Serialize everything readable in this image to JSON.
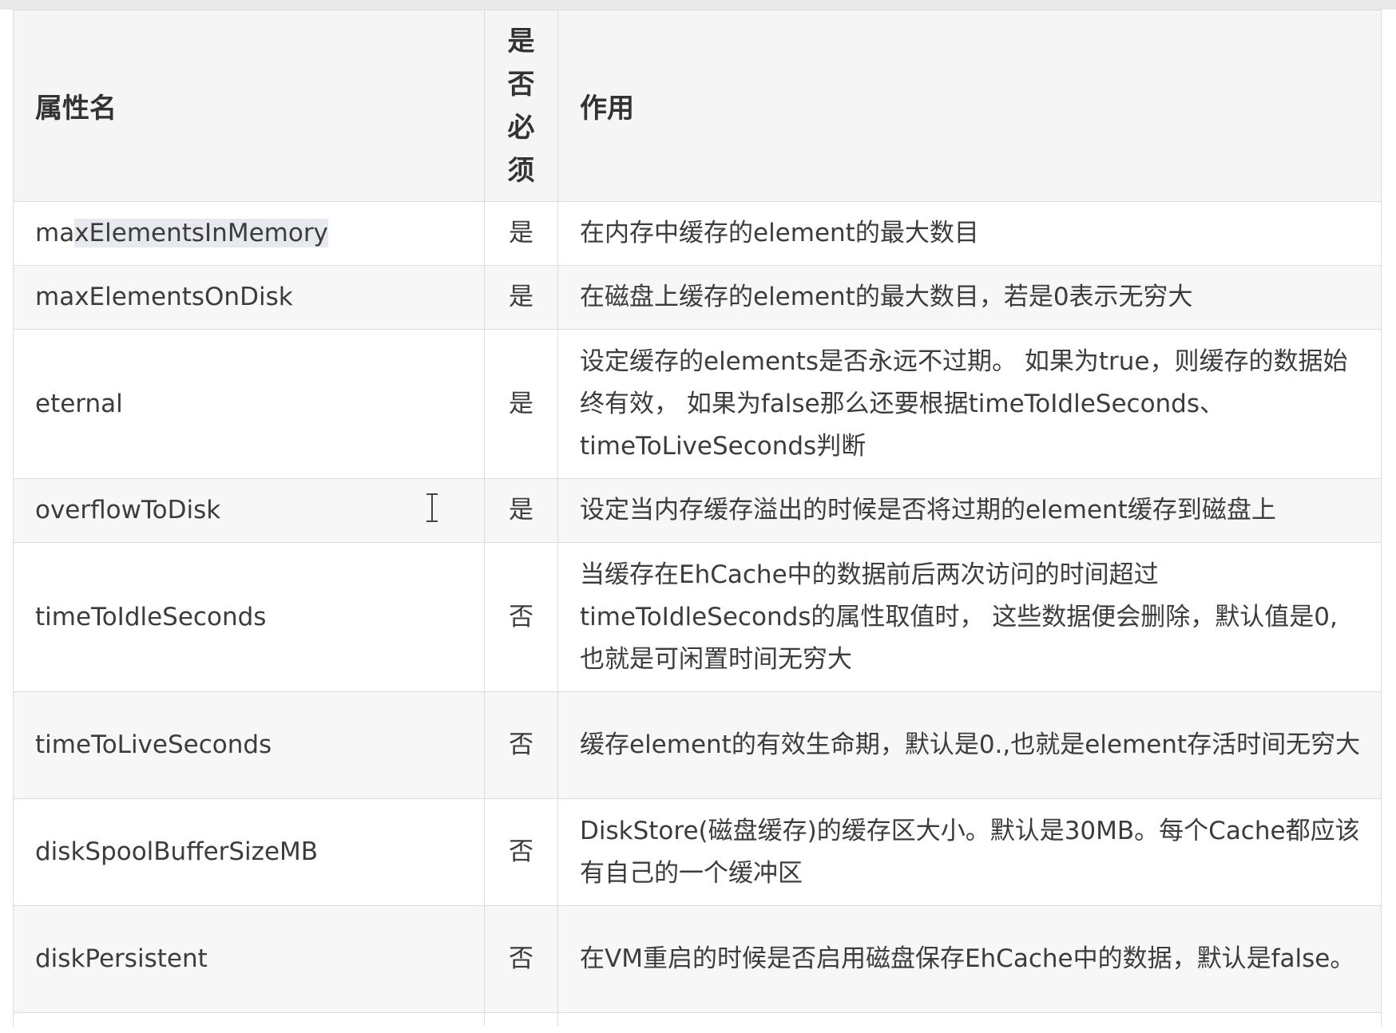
{
  "table": {
    "headers": {
      "name": "属性名",
      "required_chars": [
        "是",
        "否",
        "必",
        "须"
      ],
      "description": "作用"
    },
    "rows": [
      {
        "name_prefix": "ma",
        "name_selected": "xElementsInMemory",
        "required": "是",
        "description": "在内存中缓存的element的最大数目"
      },
      {
        "name_prefix": "maxElementsOnDisk",
        "name_selected": "",
        "required": "是",
        "description": "在磁盘上缓存的element的最大数目，若是0表示无穷大"
      },
      {
        "name_prefix": "eternal",
        "name_selected": "",
        "required": "是",
        "description": "设定缓存的elements是否永远不过期。 如果为true，则缓存的数据始终有效， 如果为false那么还要根据timeToIdleSeconds、timeToLiveSeconds判断"
      },
      {
        "name_prefix": "overflowToDisk",
        "name_selected": "",
        "required": "是",
        "description": "设定当内存缓存溢出的时候是否将过期的element缓存到磁盘上"
      },
      {
        "name_prefix": "timeToIdleSeconds",
        "name_selected": "",
        "required": "否",
        "description": "当缓存在EhCache中的数据前后两次访问的时间超过timeToIdleSeconds的属性取值时， 这些数据便会删除，默认值是0,也就是可闲置时间无穷大"
      },
      {
        "name_prefix": "timeToLiveSeconds",
        "name_selected": "",
        "required": "否",
        "description": "缓存element的有效生命期，默认是0.,也就是element存活时间无穷大"
      },
      {
        "name_prefix": "diskSpoolBufferSizeMB",
        "name_selected": "",
        "required": "否",
        "description": "DiskStore(磁盘缓存)的缓存区大小。默认是30MB。每个Cache都应该有自己的一个缓冲区"
      },
      {
        "name_prefix": "diskPersistent",
        "name_selected": "",
        "required": "否",
        "description": "在VM重启的时候是否启用磁盘保存EhCache中的数据，默认是false。"
      }
    ]
  },
  "icons": {
    "cursor": "text-cursor-icon"
  }
}
